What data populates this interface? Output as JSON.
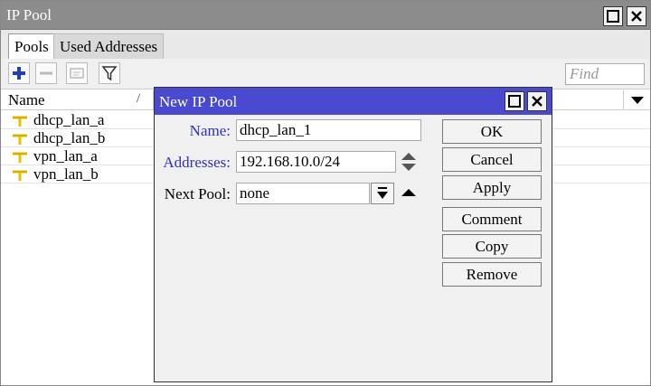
{
  "window": {
    "title": "IP Pool"
  },
  "tabs": [
    {
      "label": "Pools",
      "active": true
    },
    {
      "label": "Used Addresses",
      "active": false
    }
  ],
  "toolbar": {
    "find_placeholder": "Find"
  },
  "list": {
    "column_name": "Name",
    "sort_indicator": "/",
    "rows": [
      "dhcp_lan_a",
      "dhcp_lan_b",
      "vpn_lan_a",
      "vpn_lan_b"
    ]
  },
  "dialog": {
    "title": "New IP Pool",
    "name_label": "Name:",
    "name_value": "dhcp_lan_1",
    "addresses_label": "Addresses:",
    "addresses_value": "192.168.10.0/24",
    "next_pool_label": "Next Pool:",
    "next_pool_value": "none",
    "buttons": {
      "ok": "OK",
      "cancel": "Cancel",
      "apply": "Apply",
      "comment": "Comment",
      "copy": "Copy",
      "remove": "Remove"
    }
  },
  "colors": {
    "dialog_title_bg": "#4a4ad0",
    "label_blue": "#3030c8",
    "add_icon": "#1f3fbf",
    "pool_icon": "#e6c200"
  }
}
